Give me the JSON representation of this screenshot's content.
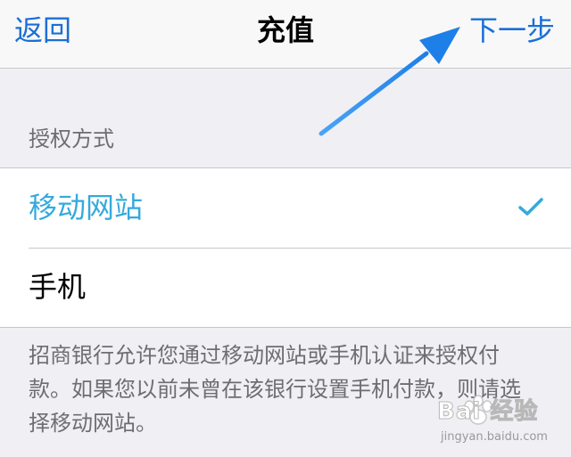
{
  "navbar": {
    "back_label": "返回",
    "title": "充值",
    "next_label": "下一步"
  },
  "section": {
    "header": "授权方式"
  },
  "options": [
    {
      "label": "移动网站",
      "selected": true
    },
    {
      "label": "手机",
      "selected": false
    }
  ],
  "footer": {
    "note": "招商银行允许您通过移动网站或手机认证来授权付款。如果您以前未曾在该银行设置手机付款，则请选择移动网站。"
  },
  "watermark": {
    "brand": "Bai  经验",
    "url": "jingyan.baidu.com"
  },
  "colors": {
    "accent": "#1a6fd6",
    "selected": "#34aadc",
    "annotation_arrow": "#2d8cf0"
  },
  "icons": {
    "checkmark": "checkmark-icon",
    "arrow": "annotation-arrow"
  }
}
